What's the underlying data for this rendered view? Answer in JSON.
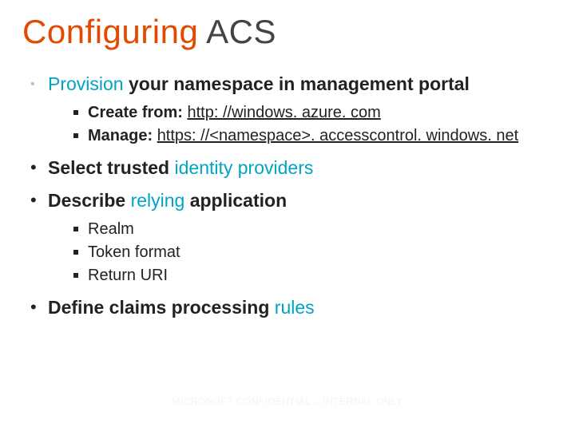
{
  "title": {
    "part1": "Configuring ",
    "part2": "ACS"
  },
  "bullets": {
    "provision": {
      "lead": "Provision",
      "rest": " your namespace in management portal",
      "sub": {
        "create_label": "Create from: ",
        "create_link": "http: //windows. azure. com",
        "manage_label": "Manage: ",
        "manage_link": "https: //<namespace>. accesscontrol. windows. net"
      }
    },
    "select": {
      "lead": "Select trusted ",
      "accent": "identity providers"
    },
    "describe": {
      "lead": "Describe ",
      "accent": "relying",
      "rest": " application",
      "sub": {
        "a": "Realm",
        "b": "Token format",
        "c": "Return URI"
      }
    },
    "define": {
      "lead": "Define claims processing ",
      "accent": "rules"
    }
  },
  "footer": "MICROSOFT CONFIDENTIAL – INTERNAL ONLY"
}
